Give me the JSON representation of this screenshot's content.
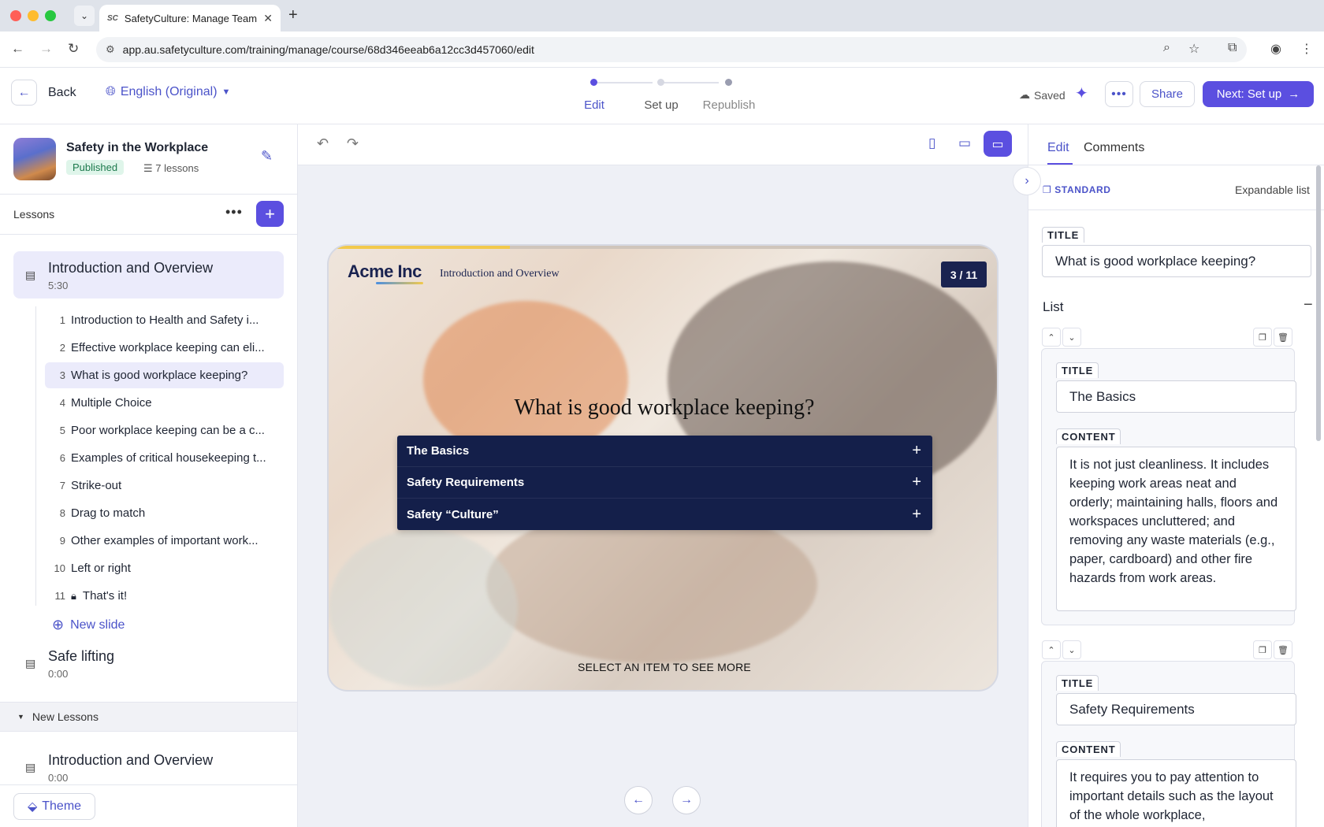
{
  "browser": {
    "tab_favicon": "SC",
    "tab_title": "SafetyCulture: Manage Teams",
    "url": "app.au.safetyculture.com/training/manage/course/68d346eeab6a12cc3d457060/edit"
  },
  "header": {
    "back_label": "Back",
    "language": "English (Original)",
    "steps": [
      {
        "label": "Edit",
        "state": "active"
      },
      {
        "label": "Set up",
        "state": "inactive"
      },
      {
        "label": "Republish",
        "state": "inactive"
      }
    ],
    "saved_label": "Saved",
    "share_label": "Share",
    "next_label": "Next: Set up"
  },
  "sidebar": {
    "course_title": "Safety in the Workplace",
    "status_badge": "Published",
    "lesson_count": "7 lessons",
    "lessons_label": "Lessons",
    "active_lesson": {
      "name": "Introduction and Overview",
      "duration": "5:30"
    },
    "slides": [
      {
        "num": "1",
        "text": "Introduction to Health and Safety i..."
      },
      {
        "num": "2",
        "text": "Effective workplace keeping can eli..."
      },
      {
        "num": "3",
        "text": "What is good workplace keeping?"
      },
      {
        "num": "4",
        "text": "Multiple Choice"
      },
      {
        "num": "5",
        "text": "Poor workplace keeping can be a c..."
      },
      {
        "num": "6",
        "text": "Examples of critical housekeeping t..."
      },
      {
        "num": "7",
        "text": "Strike-out"
      },
      {
        "num": "8",
        "text": "Drag to match"
      },
      {
        "num": "9",
        "text": "Other examples of important work..."
      },
      {
        "num": "10",
        "text": "Left or right"
      },
      {
        "num": "11",
        "text": "That's it!"
      }
    ],
    "new_slide_label": "New slide",
    "lesson_2": {
      "name": "Safe lifting",
      "duration": "0:00"
    },
    "group_label": "New Lessons",
    "lesson_3": {
      "name": "Introduction and Overview",
      "duration": "0:00"
    },
    "theme_label": "Theme"
  },
  "slide": {
    "brand": "Acme Inc",
    "section": "Introduction and Overview",
    "counter": "3 / 11",
    "progress": 0.27,
    "heading": "What is good workplace keeping?",
    "accordion": [
      {
        "label": "The Basics"
      },
      {
        "label": "Safety Requirements"
      },
      {
        "label": "Safety “Culture”"
      }
    ],
    "hint": "SELECT AN ITEM TO SEE MORE"
  },
  "panel": {
    "tabs": [
      "Edit",
      "Comments"
    ],
    "block_type": "STANDARD",
    "block_name": "Expandable list",
    "title_label": "TITLE",
    "title_value": "What is good workplace keeping?",
    "list_label": "List",
    "items": [
      {
        "title_label": "TITLE",
        "title": "The Basics",
        "content_label": "CONTENT",
        "content": "It is not just cleanliness. It includes keeping work areas neat and orderly; maintaining halls, floors and workspaces uncluttered; and removing any waste materials (e.g., paper, cardboard) and other fire hazards from work areas."
      },
      {
        "title_label": "TITLE",
        "title": "Safety Requirements",
        "content_label": "CONTENT",
        "content": "It requires you to pay attention to important details such as the layout of the whole workplace,"
      }
    ]
  },
  "colors": {
    "accent": "#5b4fe0",
    "link": "#4b53c9",
    "slide_dark": "#141f4a",
    "published_bg": "#dff5ea"
  }
}
